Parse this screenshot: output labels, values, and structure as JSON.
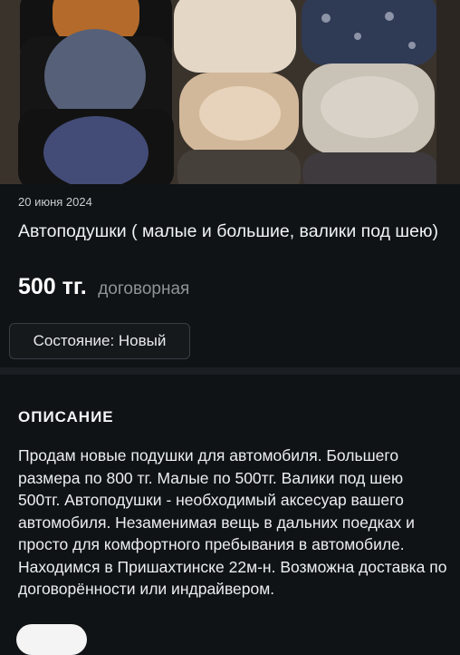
{
  "listing": {
    "date": "20 июня 2024",
    "title": "Автоподушки ( малые и большие, валики под шею)",
    "price": "500 тг.",
    "price_note": "договорная",
    "condition": "Состояние: Новый"
  },
  "description": {
    "heading": "ОПИСАНИЕ",
    "paragraph_1": "Продам новые подушки для автомобиля. Большего размера по 800 тг. Малые по 500тг. Валики под шею 500тг. Автоподушки - необходимый аксесуар вашего автомобиля. Незаменимая вещь в дальних поедках и просто для комфортного пребывания в автомобиле.",
    "paragraph_2": "Находимся в Пришахтинске 22м-н. Возможна доставка по договорённости или индрайвером."
  },
  "colors": {
    "background": "#0f1316",
    "chip_border": "#3a3f45",
    "muted_text": "#8e9398"
  }
}
